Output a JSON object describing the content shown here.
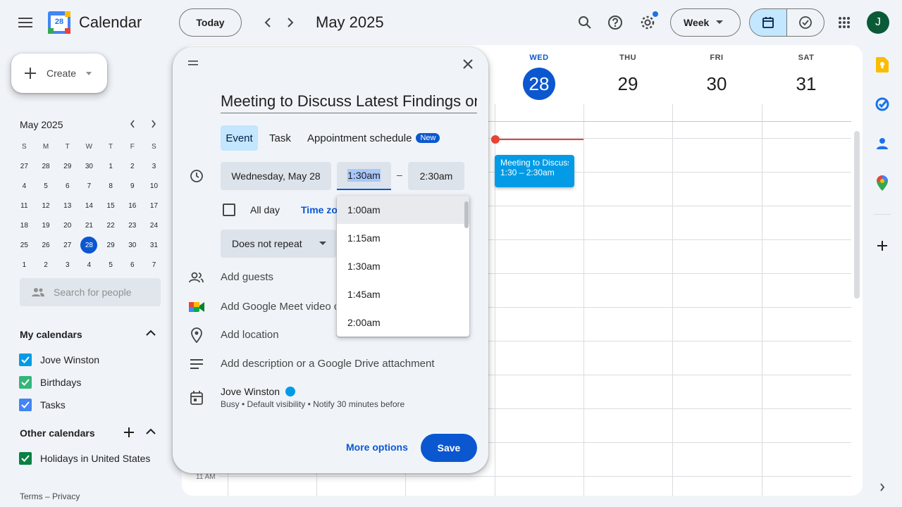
{
  "header": {
    "app_title": "Calendar",
    "logo_day": "28",
    "today_label": "Today",
    "month_title": "May 2025",
    "view_label": "Week",
    "avatar_initial": "J"
  },
  "sidebar": {
    "create_label": "Create",
    "mini_calendar": {
      "title": "May 2025",
      "weekdays": [
        "S",
        "M",
        "T",
        "W",
        "T",
        "F",
        "S"
      ],
      "days": [
        "27",
        "28",
        "29",
        "30",
        "1",
        "2",
        "3",
        "4",
        "5",
        "6",
        "7",
        "8",
        "9",
        "10",
        "11",
        "12",
        "13",
        "14",
        "15",
        "16",
        "17",
        "18",
        "19",
        "20",
        "21",
        "22",
        "23",
        "24",
        "25",
        "26",
        "27",
        "28",
        "29",
        "30",
        "31",
        "1",
        "2",
        "3",
        "4",
        "5",
        "6",
        "7"
      ],
      "selected_index": 31
    },
    "people_search_placeholder": "Search for people",
    "my_calendars_title": "My calendars",
    "my_calendars": [
      {
        "label": "Jove Winston",
        "color": "#039be5"
      },
      {
        "label": "Birthdays",
        "color": "#33b679"
      },
      {
        "label": "Tasks",
        "color": "#4285f4"
      }
    ],
    "other_calendars_title": "Other calendars",
    "other_calendars": [
      {
        "label": "Holidays in United States",
        "color": "#0b8043"
      }
    ],
    "footer": "Terms – Privacy"
  },
  "week": {
    "days": [
      {
        "dow": "WED",
        "num": "28",
        "today": true
      },
      {
        "dow": "THU",
        "num": "29",
        "today": false
      },
      {
        "dow": "FRI",
        "num": "30",
        "today": false
      },
      {
        "dow": "SAT",
        "num": "31",
        "today": false
      }
    ],
    "time_label": "11 AM",
    "event": {
      "title": "Meeting to Discuss",
      "time": "1:30 – 2:30am"
    }
  },
  "dialog": {
    "title_value": "Meeting to Discuss Latest Findings on",
    "tabs": {
      "event": "Event",
      "task": "Task",
      "appointment": "Appointment schedule",
      "new_badge": "New"
    },
    "date": "Wednesday, May 28",
    "start_time": "1:30am",
    "dash": "–",
    "end_time": "2:30am",
    "all_day": "All day",
    "time_zone": "Time zone",
    "repeat": "Does not repeat",
    "add_guests": "Add guests",
    "add_meet": "Add Google Meet video conferencing",
    "add_location": "Add location",
    "add_description": "Add description or a Google Drive attachment",
    "owner": "Jove Winston",
    "owner_details": "Busy • Default visibility • Notify 30 minutes before",
    "more_options": "More options",
    "save": "Save"
  },
  "time_dropdown": {
    "options": [
      "1:00am",
      "1:15am",
      "1:30am",
      "1:45am",
      "2:00am"
    ],
    "highlighted_index": 0
  },
  "colors": {
    "accent": "#0b57d0",
    "event": "#039be5",
    "now_line": "#ea4335"
  }
}
